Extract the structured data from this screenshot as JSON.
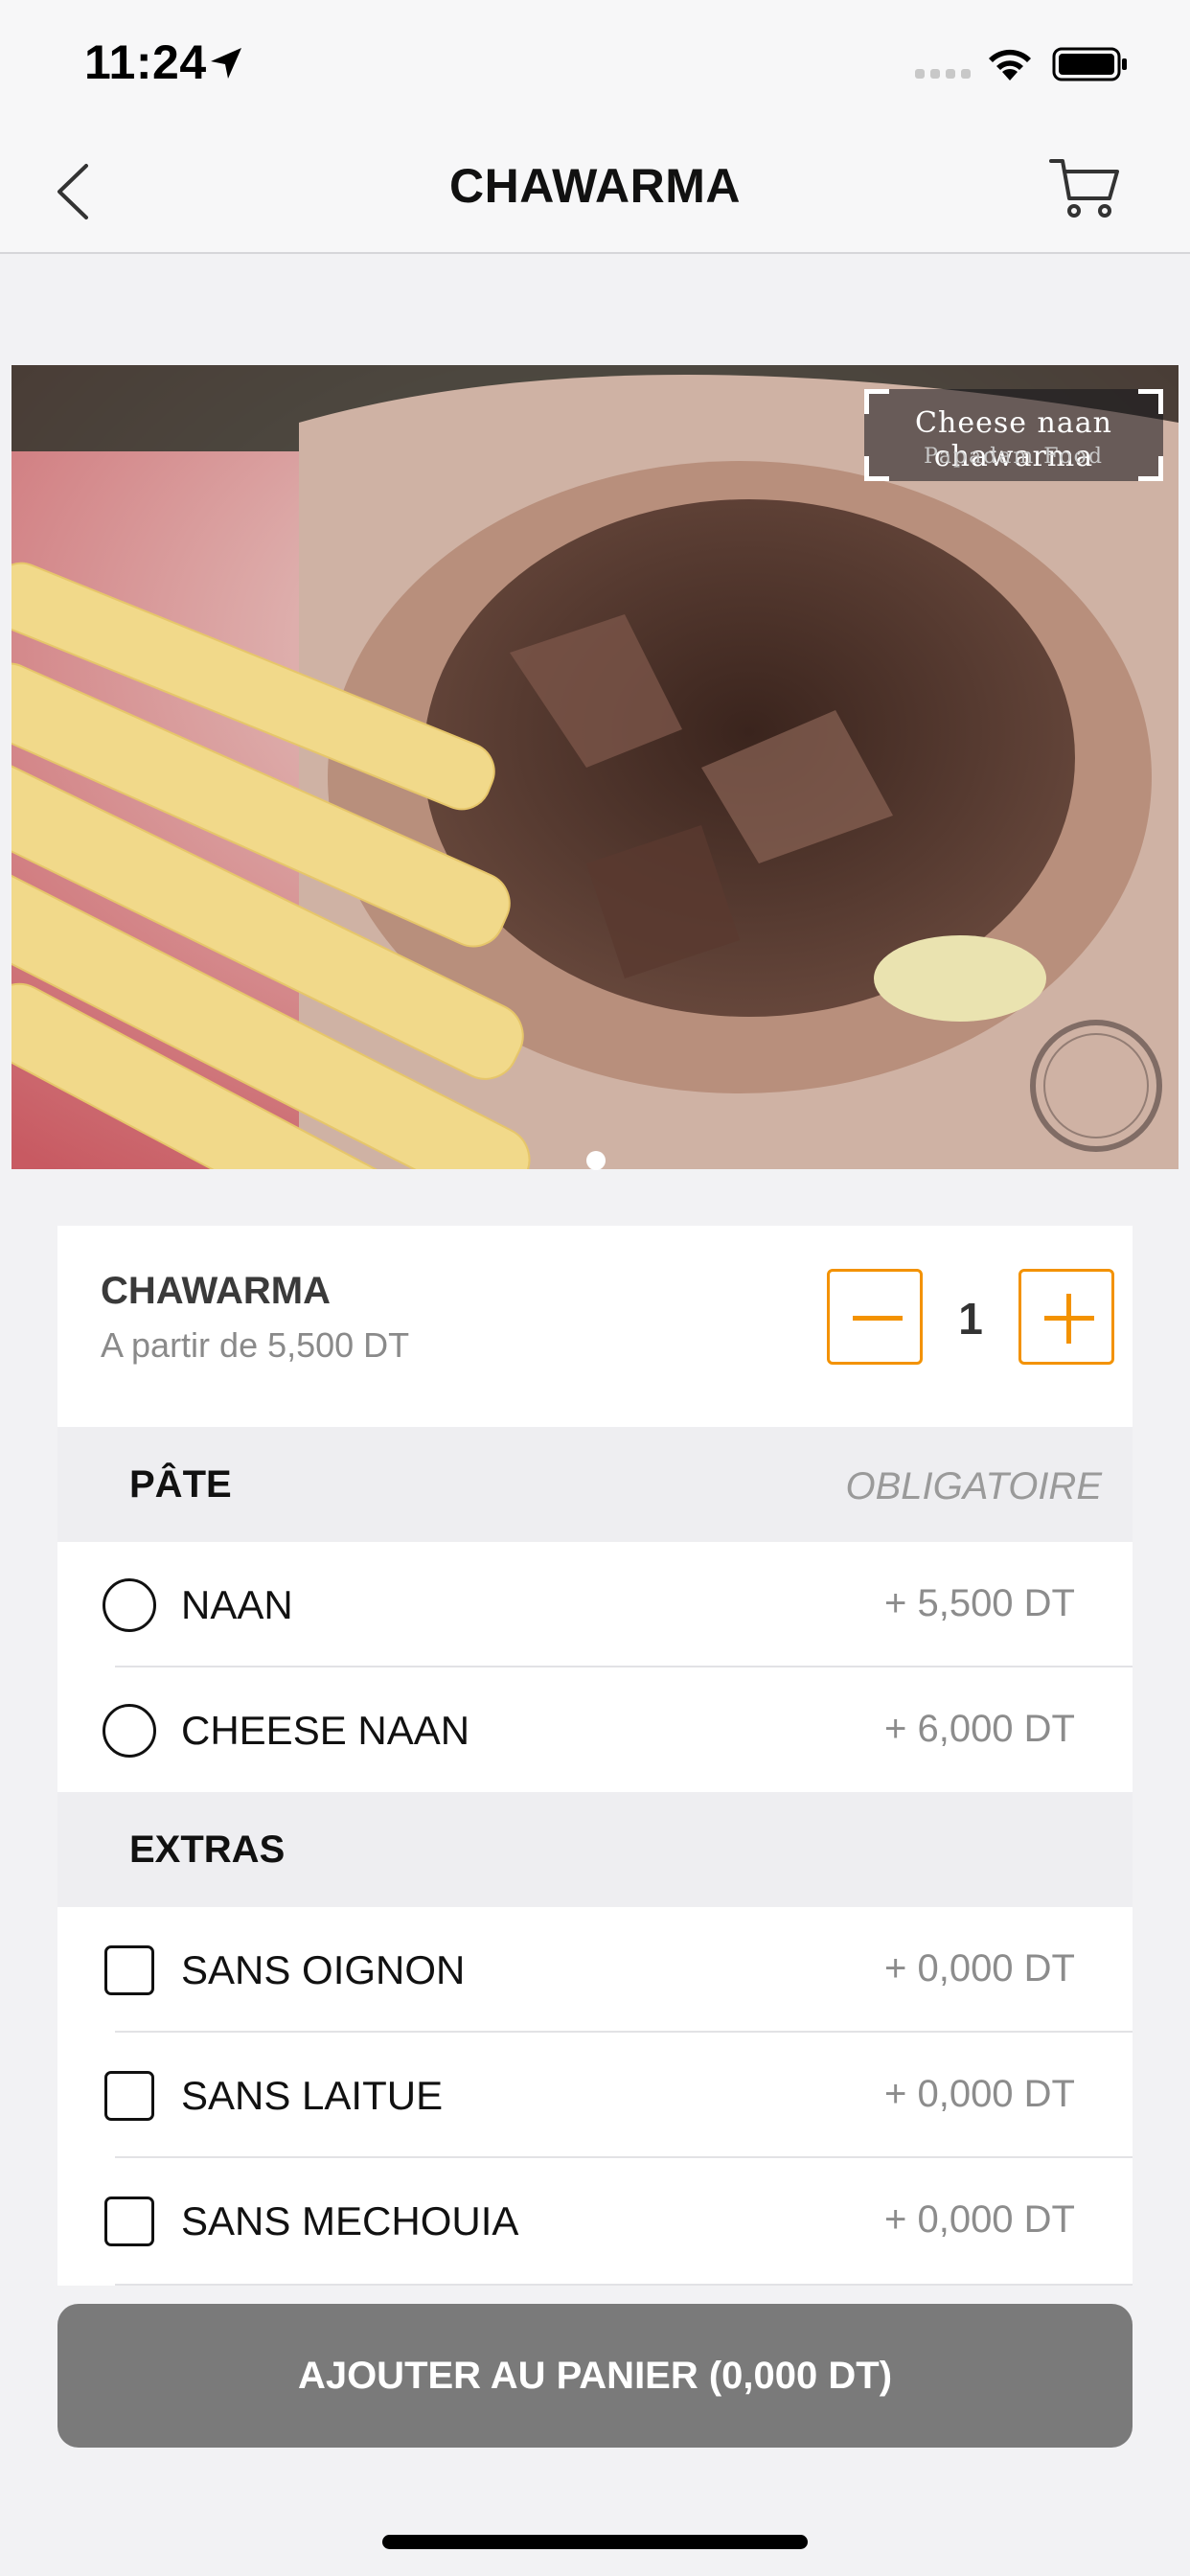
{
  "status_bar": {
    "time": "11:24",
    "icons": [
      "location-arrow-icon",
      "cellular-signal-icon",
      "wifi-icon",
      "battery-icon"
    ]
  },
  "nav": {
    "title": "CHAWARMA",
    "back_icon": "chevron-left-icon",
    "cart_icon": "shopping-cart-icon"
  },
  "hero": {
    "caption_title": "Cheese naan chawarma",
    "caption_subtitle": "Papadam Food",
    "page_count": 1,
    "current_page": 1
  },
  "product": {
    "name": "CHAWARMA",
    "price_text": "A partir de 5,500 DT",
    "quantity": "1"
  },
  "sections": [
    {
      "title": "PÂTE",
      "note": "OBLIGATOIRE",
      "control": "radio",
      "options": [
        {
          "label": "NAAN",
          "price": "+ 5,500 DT"
        },
        {
          "label": "CHEESE NAAN",
          "price": "+ 6,000 DT"
        }
      ]
    },
    {
      "title": "EXTRAS",
      "note": "",
      "control": "checkbox",
      "options": [
        {
          "label": "SANS OIGNON",
          "price": "+ 0,000 DT"
        },
        {
          "label": "SANS LAITUE",
          "price": "+ 0,000 DT"
        },
        {
          "label": "SANS MECHOUIA",
          "price": "+ 0,000 DT"
        }
      ]
    }
  ],
  "add_button": {
    "label": "AJOUTER AU PANIER (0,000 DT)"
  },
  "colors": {
    "accent": "#f39200",
    "background": "#f2f2f4",
    "button": "#7a7a7a",
    "section_header": "#eeeef1"
  }
}
